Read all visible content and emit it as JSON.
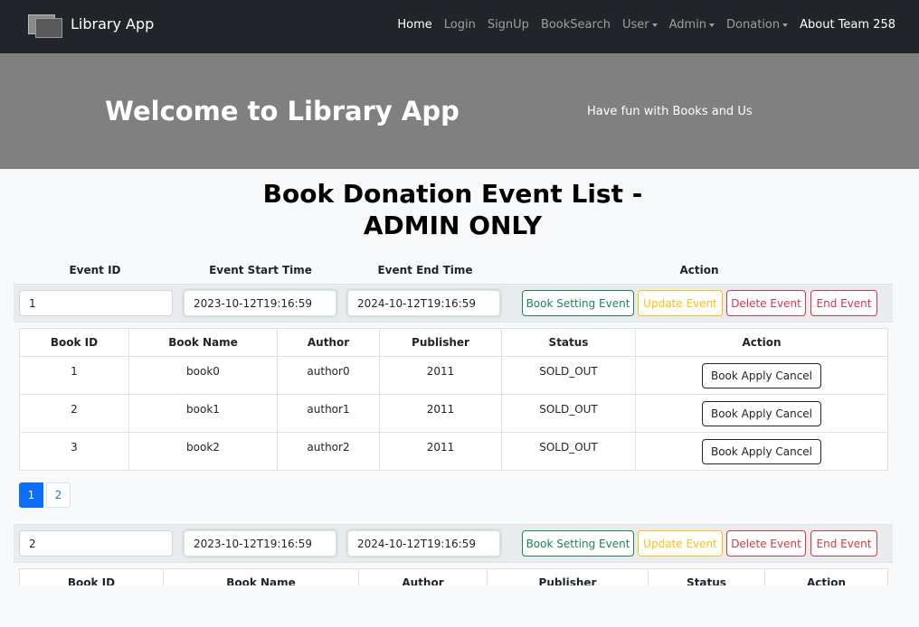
{
  "navbar": {
    "brand": "Library App",
    "items": [
      {
        "label": "Home",
        "active": true,
        "dropdown": false
      },
      {
        "label": "Login",
        "active": false,
        "dropdown": false
      },
      {
        "label": "SignUp",
        "active": false,
        "dropdown": false
      },
      {
        "label": "BookSearch",
        "active": false,
        "dropdown": false
      },
      {
        "label": "User",
        "active": false,
        "dropdown": true
      },
      {
        "label": "Admin",
        "active": false,
        "dropdown": true
      },
      {
        "label": "Donation",
        "active": false,
        "dropdown": true
      },
      {
        "label": "About Team 258",
        "active": true,
        "dropdown": false
      }
    ]
  },
  "hero": {
    "title": "Welcome to Library App",
    "subtitle": "Have fun with Books and Us"
  },
  "page_title_line1": "Book Donation Event List -",
  "page_title_line2": "ADMIN ONLY",
  "event_headers": {
    "id": "Event ID",
    "start": "Event Start Time",
    "end": "Event End Time",
    "action": "Action"
  },
  "buttons": {
    "setting": "Book Setting Event",
    "update": "Update Event",
    "delete": "Delete Event",
    "end": "End Event",
    "apply_cancel": "Book Apply Cancel"
  },
  "book_headers": [
    "Book ID",
    "Book Name",
    "Author",
    "Publisher",
    "Status",
    "Action"
  ],
  "events": [
    {
      "id": "1",
      "start": "2023-10-12T19:16:59",
      "end": "2024-10-12T19:16:59",
      "books": [
        {
          "id": "1",
          "name": "book0",
          "author": "author0",
          "publisher": "2011",
          "status": "SOLD_OUT"
        },
        {
          "id": "2",
          "name": "book1",
          "author": "author1",
          "publisher": "2011",
          "status": "SOLD_OUT"
        },
        {
          "id": "3",
          "name": "book2",
          "author": "author2",
          "publisher": "2011",
          "status": "SOLD_OUT"
        }
      ],
      "pages": [
        "1",
        "2"
      ]
    },
    {
      "id": "2",
      "start": "2023-10-12T19:16:59",
      "end": "2024-10-12T19:16:59",
      "books": [],
      "pages": []
    }
  ],
  "colors": {
    "navbar": "#212529",
    "hero": "#808080",
    "primary": "#0d6efd",
    "success": "#198754",
    "warning": "#ffc107",
    "danger": "#dc3545"
  }
}
